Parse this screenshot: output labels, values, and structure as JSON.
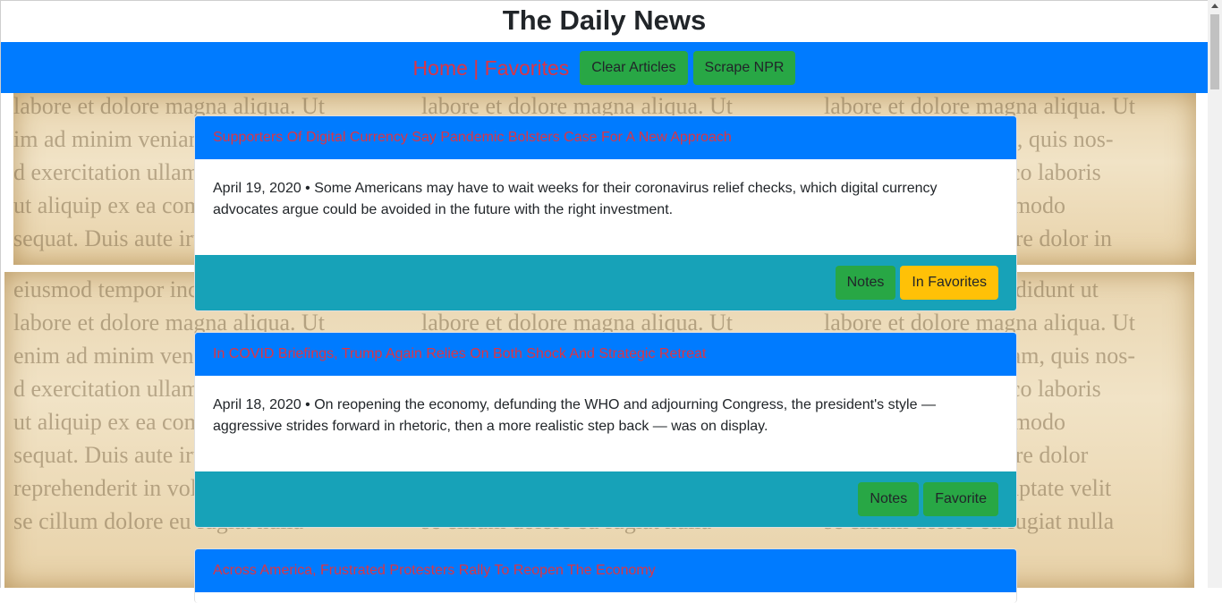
{
  "header": {
    "title": "The Daily News"
  },
  "nav": {
    "home_label": "Home",
    "separator": " | ",
    "favorites_label": "Favorites",
    "clear_label": "Clear Articles",
    "scrape_label": "Scrape NPR"
  },
  "articles": [
    {
      "title": "Supporters Of Digital Currency Say Pandemic Bolsters Case For A New Approach",
      "summary": "April 19, 2020 • Some Americans may have to wait weeks for their coronavirus relief checks, which digital currency advocates argue could be avoided in the future with the right investment.",
      "notes_label": "Notes",
      "favorite_label": "In Favorites"
    },
    {
      "title": "In COVID Briefings, Trump Again Relies On Both Shock And Strategic Retreat",
      "summary": "April 18, 2020 • On reopening the economy, defunding the WHO and adjourning Congress, the president's style — aggressive strides forward in rhetoric, then a more realistic step back — was on display.",
      "notes_label": "Notes",
      "favorite_label": "Favorite"
    },
    {
      "title": "Across America, Frustrated Protesters Rally To Reopen The Economy"
    }
  ],
  "background_text": {
    "lines": [
      "labore et dolore magna aliqua. Ut",
      "im ad minim veniam, quis nos-",
      "d exercitation ullamco laboris",
      "ut aliquip ex ea commodo",
      "sequat. Duis aute irure dolor in",
      "eiusmod tempor incididunt ut",
      "labore et dolore magna aliqua. Ut",
      "enim ad minim veniam, quis nos-",
      "d exercitation ullamco laboris",
      "ut aliquip ex ea commodo",
      "sequat. Duis aute irure dolor",
      "reprehenderit in voluptate velit",
      "se cillum dolore eu fugiat nulla"
    ]
  },
  "colors": {
    "navbar": "#007bff",
    "link_red": "#dc3545",
    "button_green": "#28a745",
    "button_yellow": "#ffc107",
    "footer_teal": "#17a2b8"
  }
}
